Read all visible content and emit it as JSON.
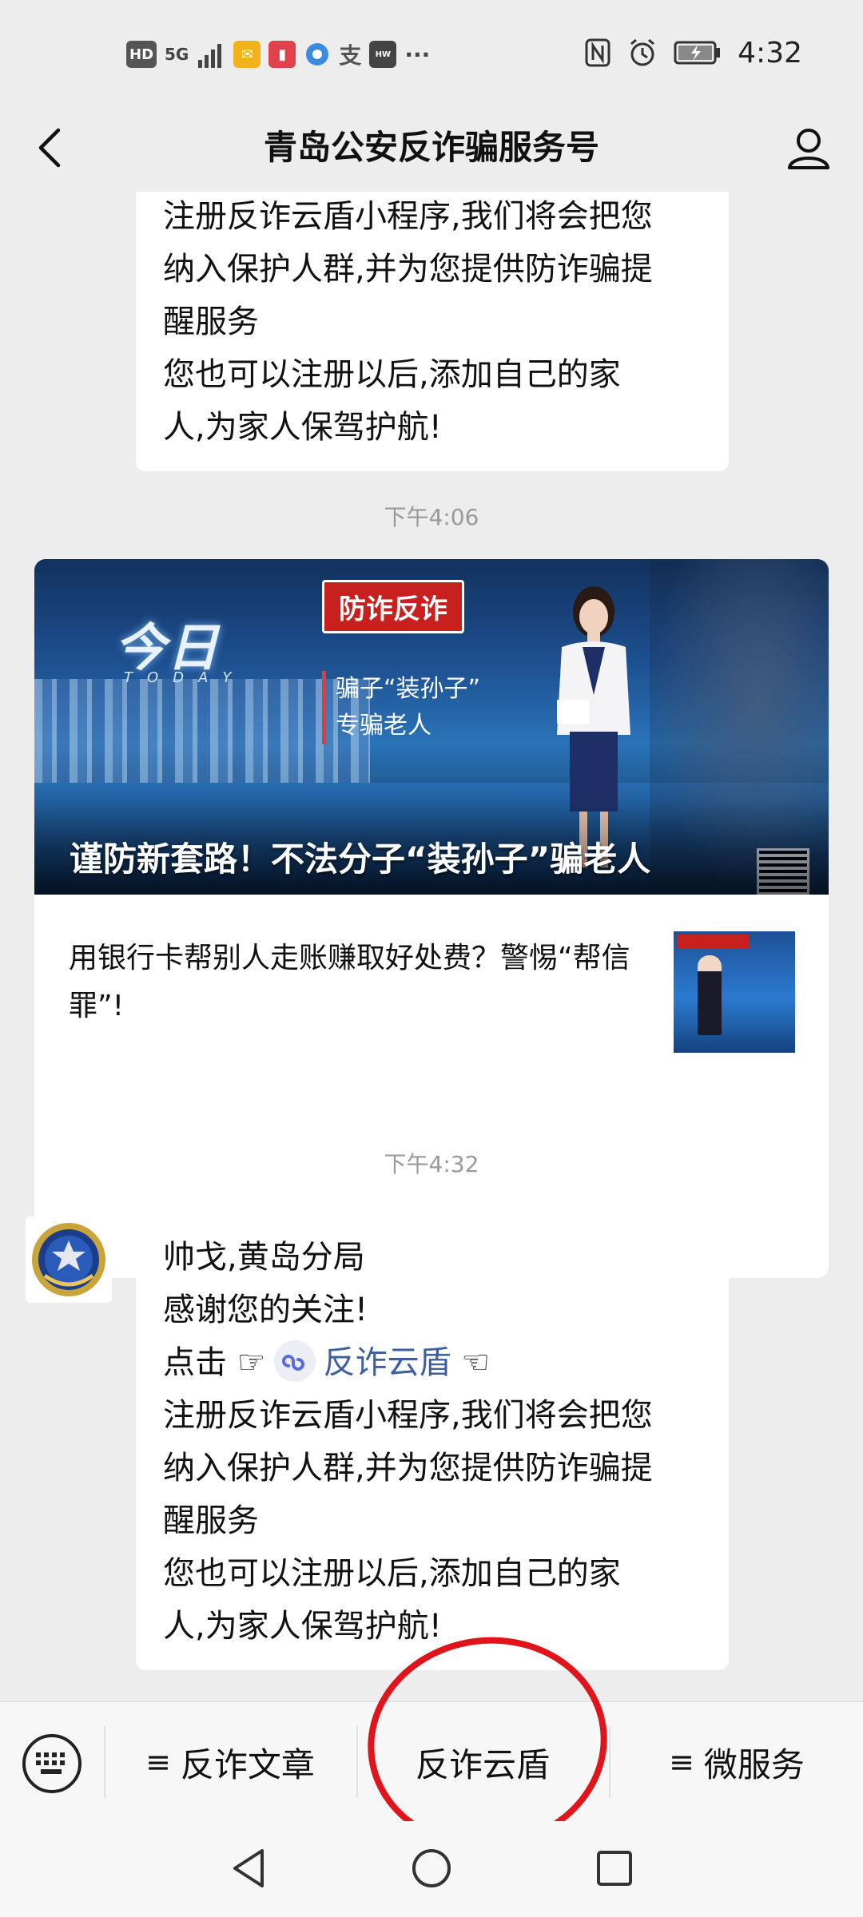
{
  "status_bar": {
    "hd_badge": "HD",
    "network": "5G",
    "time": "4:32"
  },
  "header": {
    "title": "青岛公安反诈骗服务号"
  },
  "messages": {
    "top_bubble_lines": [
      "注册反诈云盾小程序,我们将会把您",
      "纳入保护人群,并为您提供防诈骗提",
      "醒服务",
      "您也可以注册以后,添加自己的家",
      "人,为家人保驾护航!"
    ],
    "timestamp_1": "下午4:06",
    "timestamp_2": "下午4:32",
    "bottom_bubble": {
      "line1": "帅戈,黄岛分局",
      "line2": "感谢您的关注!",
      "click_prefix": "点击 ☞",
      "link_text": "反诈云盾",
      "click_suffix": "☜",
      "rest_lines": [
        "注册反诈云盾小程序,我们将会把您",
        "纳入保护人群,并为您提供防诈骗提",
        "醒服务",
        "您也可以注册以后,添加自己的家",
        "人,为家人保驾护航!"
      ]
    }
  },
  "article": {
    "hero_title": "谨防新套路！不法分子“装孙子”骗老人",
    "hero_tag": "防诈反诈",
    "hero_caption_1": "骗子“装孙子”",
    "hero_caption_2": "专骗老人",
    "hero_logo": "今日",
    "hero_logo_sub": "TODAY",
    "sub_title": "用银行卡帮别人走账赚取好处费？警惕“帮信罪”!"
  },
  "bottom_menu": {
    "item_1": "反诈文章",
    "item_2": "反诈云盾",
    "item_3": "微服务",
    "menu_glyph": "≡"
  },
  "colors": {
    "link": "#3e5f9e",
    "annotation_circle": "#e0141b",
    "tag_red": "#c8201f",
    "background": "#ededed"
  },
  "icons": {
    "back": "back-arrow-icon",
    "profile": "person-icon",
    "keyboard": "keyboard-icon",
    "mini_program": "mini-program-icon",
    "nav_back": "triangle-back-icon",
    "nav_home": "circle-home-icon",
    "nav_recent": "square-recent-icon"
  }
}
